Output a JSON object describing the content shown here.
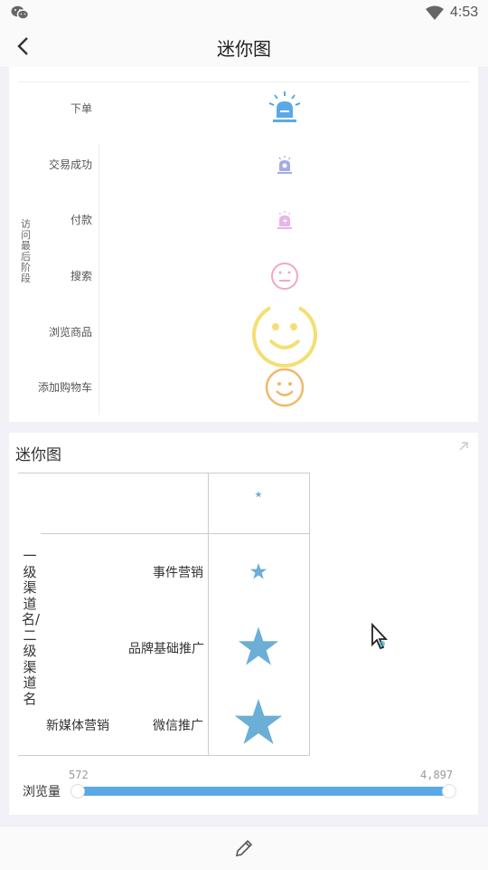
{
  "status": {
    "time": "4:53"
  },
  "header": {
    "title": "迷你图"
  },
  "card1": {
    "axis_label": "访问最后阶段",
    "rows": [
      "下单",
      "交易成功",
      "付款",
      "搜索",
      "浏览商品",
      "添加购物车"
    ]
  },
  "card2": {
    "title": "迷你图",
    "axis_label": "一级渠道名/二级渠道名",
    "level1": "新媒体营销",
    "level2": [
      "事件营销",
      "品牌基础推广",
      "微信推广"
    ],
    "slider": {
      "label": "浏览量",
      "min": "572",
      "max": "4,897"
    }
  },
  "colors": {
    "accent": "#5aa9e6",
    "star": "#6baed6"
  }
}
